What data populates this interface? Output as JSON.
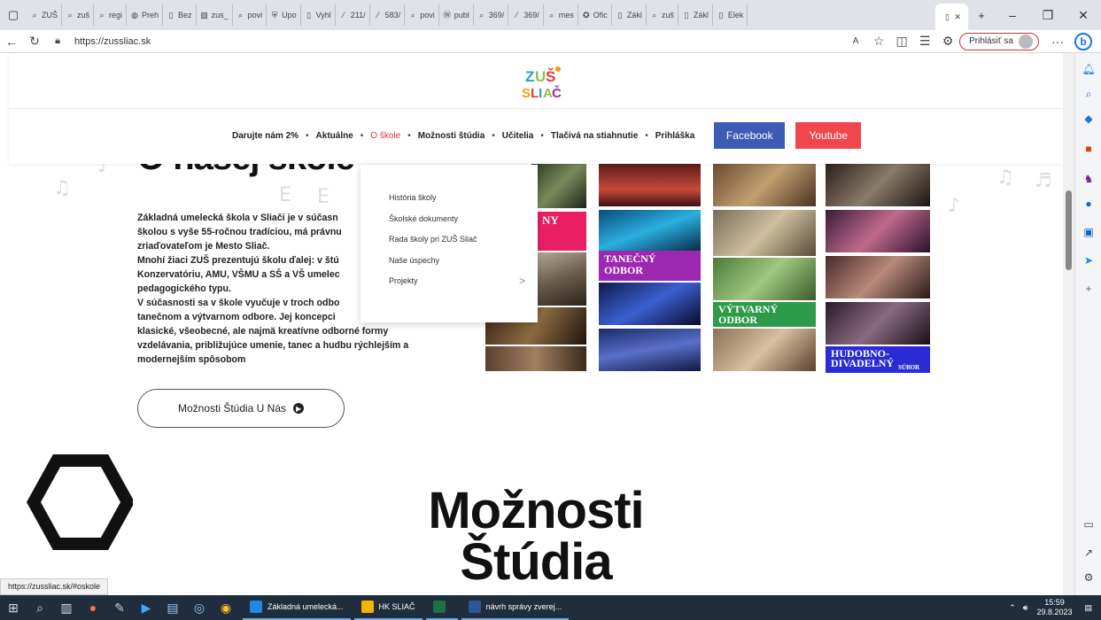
{
  "browser": {
    "tabs": [
      {
        "label": "ZUŠ",
        "icon": "search-icon"
      },
      {
        "label": "zuš",
        "icon": "search-icon"
      },
      {
        "label": "regi",
        "icon": "search-icon"
      },
      {
        "label": "Preh",
        "icon": "globe-icon"
      },
      {
        "label": "Bez",
        "icon": "page-icon"
      },
      {
        "label": "zus_",
        "icon": "image-icon"
      },
      {
        "label": "povi",
        "icon": "search-icon"
      },
      {
        "label": "Upo",
        "icon": "shield-icon"
      },
      {
        "label": "Vyhl",
        "icon": "page-icon"
      },
      {
        "label": "211/",
        "icon": "slash-icon"
      },
      {
        "label": "583/",
        "icon": "slash-icon"
      },
      {
        "label": "povi",
        "icon": "search-icon"
      },
      {
        "label": "publ",
        "icon": "wordpress-icon"
      },
      {
        "label": "369/",
        "icon": "search-icon"
      },
      {
        "label": "369/",
        "icon": "slash-icon"
      },
      {
        "label": "mes",
        "icon": "search-icon"
      },
      {
        "label": "Ofic",
        "icon": "badge-icon"
      },
      {
        "label": "Zákl",
        "icon": "page-icon"
      },
      {
        "label": "zuš",
        "icon": "search-icon"
      },
      {
        "label": "Zákl",
        "icon": "page-icon"
      },
      {
        "label": "Elek",
        "icon": "page-icon"
      }
    ],
    "url": "https://zussliac.sk",
    "login_label": "Prihlásiť sa"
  },
  "site": {
    "logo_text": "ZUŠ SLIAČ",
    "menu": [
      {
        "label": "Darujte nám 2%",
        "active": false
      },
      {
        "label": "Aktuálne",
        "active": false
      },
      {
        "label": "O škole",
        "active": true
      },
      {
        "label": "Možnosti štúdia",
        "active": false
      },
      {
        "label": "Učitelia",
        "active": false
      },
      {
        "label": "Tlačivá na stiahnutie",
        "active": false
      },
      {
        "label": "Prihláška",
        "active": false
      }
    ],
    "facebook_label": "Facebook",
    "youtube_label": "Youtube",
    "dropdown": [
      "História školy",
      "Školské dokumenty",
      "Rada školy pri ZUŠ Sliač",
      "Naše úspechy",
      "Projekty"
    ],
    "dropdown_arrow": ">",
    "hero_title": "O našej škole",
    "intro_lines": [
      "Základná umelecká škola v Sliači je v súčasn",
      "školou s vyše 55-ročnou tradíciou, má právnu",
      "zriaďovateľom je Mesto Sliač.",
      "Mnohí žiaci ZUŠ prezentujú školu ďalej: v štú",
      "Konzervatóriu, AMU, VŠMU a SŠ a VŠ umelec",
      "pedagogického typu.",
      "V súčasnosti sa v škole vyučuje v troch odbo",
      "tanečnom a výtvarnom odbore. Jej koncepci",
      "klasické, všeobecné, ale najmä kreatívne odborné formy",
      "vzdelávania, približujúce umenie, tanec a hudbu rýchlejším a",
      "modernejším spôsobom"
    ],
    "study_button": "Možnosti Štúdia U Nás",
    "collage_labels": {
      "music": "NY",
      "dance_1": "TANEČNÝ",
      "dance_2": "ODBOR",
      "art_1": "VÝTVARNÝ",
      "art_2": "ODBOR",
      "drama_1": "HUDOBNO-",
      "drama_2": "DIVADELNÝ",
      "drama_3": "SÚBOR"
    },
    "big_heading_1": "Možnosti",
    "big_heading_2": "Štúdia",
    "status_url": "https://zussliac.sk/#oskole"
  },
  "taskbar": {
    "apps": [
      {
        "label": "Základná umelecká...",
        "color": "#1e88e5"
      },
      {
        "label": "HK SLIAČ",
        "color": "#f4b400"
      },
      {
        "label": "",
        "color": "#1d7044"
      },
      {
        "label": "návrh správy zverej...",
        "color": "#2b579a"
      }
    ],
    "time": "15:59",
    "date": "29.8.2023"
  },
  "colors": {
    "accent_red": "#e53935",
    "facebook": "#3b5bb5",
    "youtube": "#f0474f",
    "dance_label": "#9c27b0",
    "art_label": "#2e9b4a",
    "drama_label": "#2b2bd6",
    "music_label": "#e91e63"
  }
}
